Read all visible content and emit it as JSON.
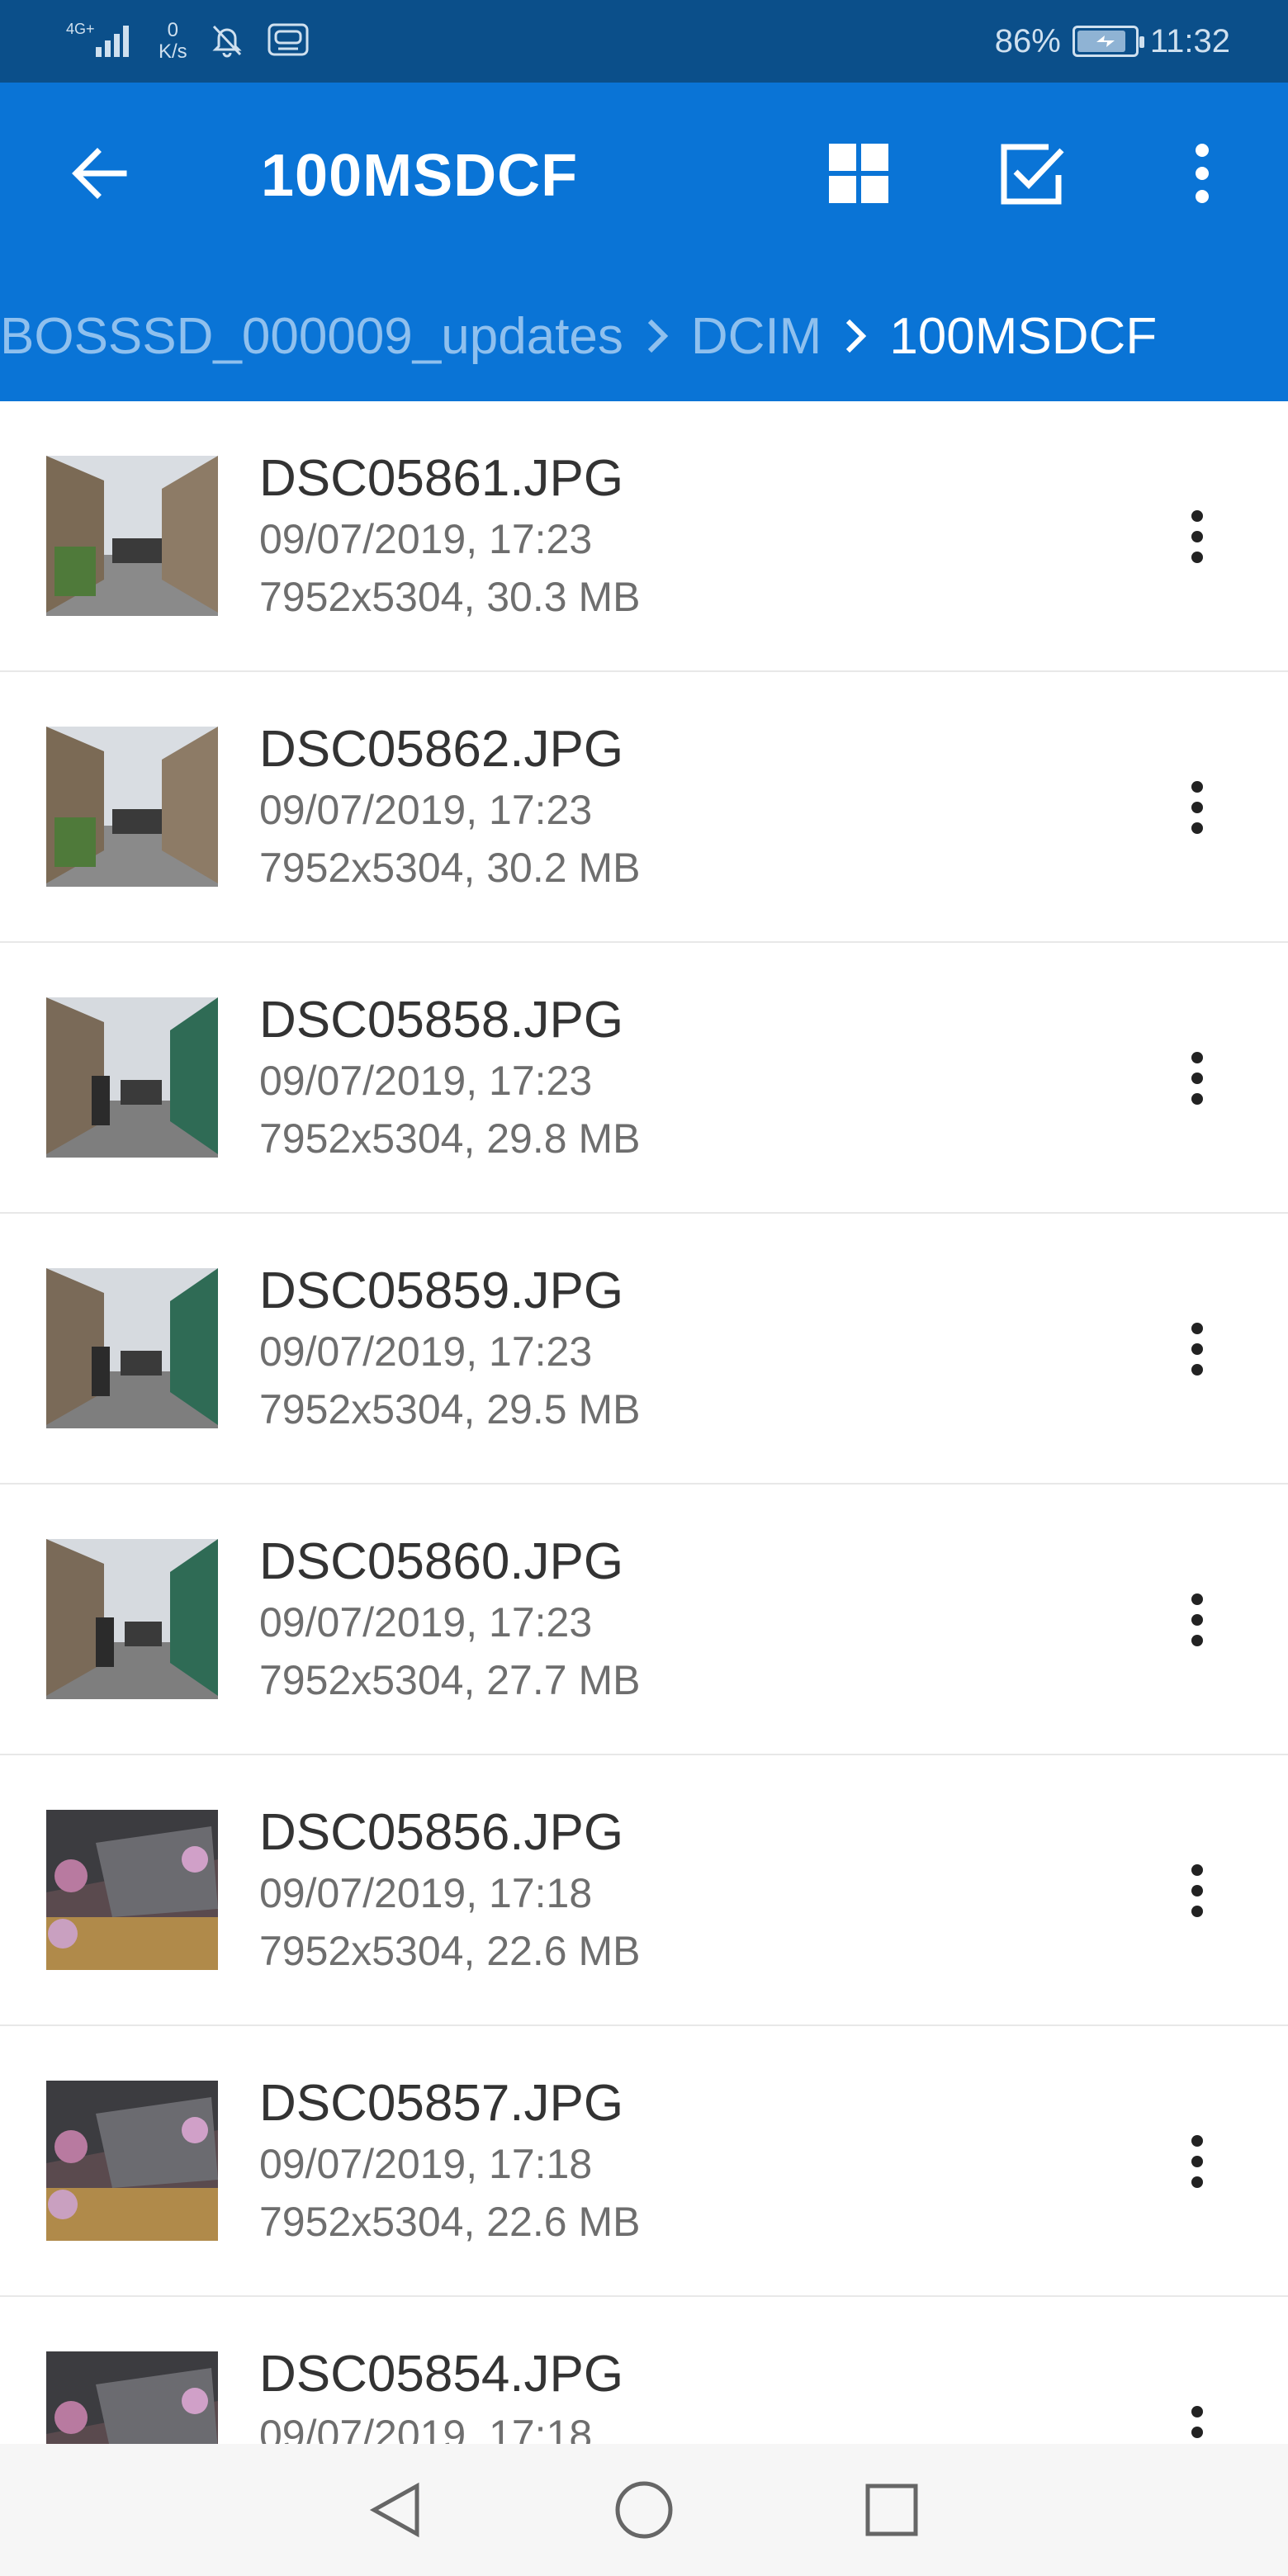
{
  "status_bar": {
    "network": "4G+",
    "net_speed_value": "0",
    "net_speed_unit": "K/s",
    "battery_percent": "86%",
    "battery_level": 0.86,
    "time": "11:32"
  },
  "app_bar": {
    "title": "100MSDCF",
    "icons": [
      "arrow-left-icon",
      "grid-view-icon",
      "select-checkbox-icon",
      "more-vertical-icon"
    ]
  },
  "breadcrumb": {
    "items": [
      "BOSSSD_000009_updates",
      "DCIM",
      "100MSDCF"
    ]
  },
  "files": [
    {
      "name": "DSC05861.JPG",
      "date": "09/07/2019, 17:23",
      "meta": "7952x5304, 30.3 MB"
    },
    {
      "name": "DSC05862.JPG",
      "date": "09/07/2019, 17:23",
      "meta": "7952x5304, 30.2 MB"
    },
    {
      "name": "DSC05858.JPG",
      "date": "09/07/2019, 17:23",
      "meta": "7952x5304, 29.8 MB"
    },
    {
      "name": "DSC05859.JPG",
      "date": "09/07/2019, 17:23",
      "meta": "7952x5304, 29.5 MB"
    },
    {
      "name": "DSC05860.JPG",
      "date": "09/07/2019, 17:23",
      "meta": "7952x5304, 27.7 MB"
    },
    {
      "name": "DSC05856.JPG",
      "date": "09/07/2019, 17:18",
      "meta": "7952x5304, 22.6 MB"
    },
    {
      "name": "DSC05857.JPG",
      "date": "09/07/2019, 17:18",
      "meta": "7952x5304, 22.6 MB"
    },
    {
      "name": "DSC05854.JPG",
      "date": "09/07/2019, 17:18",
      "meta": ""
    }
  ],
  "nav_bar": {
    "icons": [
      "back-triangle-icon",
      "home-circle-icon",
      "recents-square-icon"
    ]
  }
}
